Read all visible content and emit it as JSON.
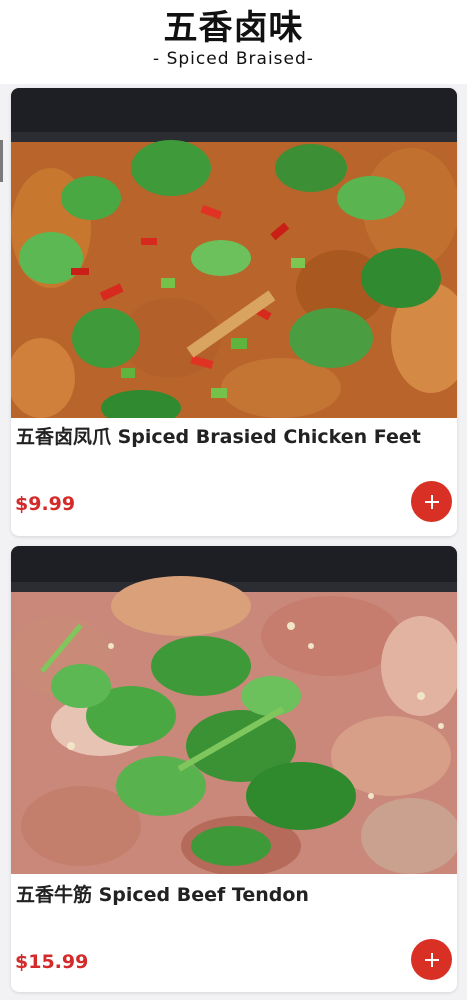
{
  "header": {
    "title": "五香卤味",
    "subtitle": "- Spiced Braised-"
  },
  "items": [
    {
      "name": "五香卤凤爪 Spiced Brasied Chicken Feet",
      "price": "$9.99",
      "add_icon": "plus-icon",
      "photo": "braised chicken feet with cilantro, chili and scallion"
    },
    {
      "name": "五香牛筋 Spiced Beef Tendon",
      "price": "$15.99",
      "add_icon": "plus-icon",
      "photo": "braised beef tendon with cilantro and garlic"
    }
  ],
  "colors": {
    "price": "#d42a2a",
    "add_button": "#d93025",
    "background": "#f2f2f4"
  }
}
